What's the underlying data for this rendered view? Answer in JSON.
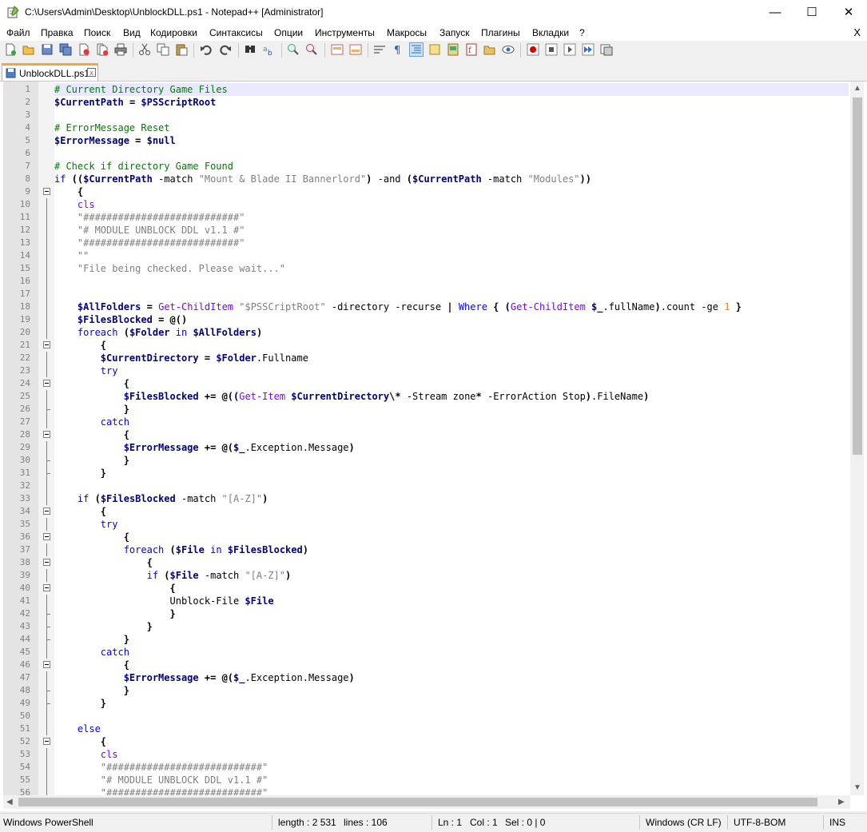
{
  "window": {
    "title": "C:\\Users\\Admin\\Desktop\\UnblockDLL.ps1 - Notepad++ [Administrator]",
    "minimize": "—",
    "maximize": "☐",
    "close": "✕"
  },
  "menu": {
    "items": [
      "Файл",
      "Правка",
      "Поиск",
      "Вид",
      "Кодировки",
      "Синтаксисы",
      "Опции",
      "Инструменты",
      "Макросы",
      "Запуск",
      "Плагины",
      "Вкладки",
      "?"
    ],
    "close_label": "X"
  },
  "tab": {
    "label": "UnblockDLL.ps1",
    "close": "x"
  },
  "colors": {
    "comment": "#008000",
    "keyword": "#0000ff",
    "variable": "#000080",
    "string": "#808080",
    "cmdlet": "#8000ff",
    "number": "#ff8000",
    "current_line": "#e8e8ff"
  },
  "editor": {
    "lines": [
      {
        "n": "1",
        "t": "# Current Directory Game Files"
      },
      {
        "n": "2",
        "t": "$CurrentPath = $PSScriptRoot"
      },
      {
        "n": "3",
        "t": ""
      },
      {
        "n": "4",
        "t": "# ErrorMessage Reset"
      },
      {
        "n": "5",
        "t": "$ErrorMessage = $null"
      },
      {
        "n": "6",
        "t": ""
      },
      {
        "n": "7",
        "t": "# Check if directory Game Found"
      },
      {
        "n": "8",
        "t": "if (($CurrentPath -match \"Mount & Blade II Bannerlord\") -and ($CurrentPath -match \"Modules\"))"
      },
      {
        "n": "9",
        "t": "    {"
      },
      {
        "n": "10",
        "t": "    cls"
      },
      {
        "n": "11",
        "t": "    \"###########################\""
      },
      {
        "n": "12",
        "t": "    \"# MODULE UNBLOCK DDL v1.1 #\""
      },
      {
        "n": "13",
        "t": "    \"###########################\""
      },
      {
        "n": "14",
        "t": "    \"\""
      },
      {
        "n": "15",
        "t": "    \"File being checked. Please wait...\""
      },
      {
        "n": "16",
        "t": ""
      },
      {
        "n": "17",
        "t": ""
      },
      {
        "n": "18",
        "t": "    $AllFolders = Get-ChildItem \"$PSSCriptRoot\" -directory -recurse | Where { (Get-ChildItem $_.fullName).count -ge 1 }"
      },
      {
        "n": "19",
        "t": "    $FilesBlocked = @()"
      },
      {
        "n": "20",
        "t": "    foreach ($Folder in $AllFolders)"
      },
      {
        "n": "21",
        "t": "        {"
      },
      {
        "n": "22",
        "t": "        $CurrentDirectory = $Folder.Fullname"
      },
      {
        "n": "23",
        "t": "        try"
      },
      {
        "n": "24",
        "t": "            {"
      },
      {
        "n": "25",
        "t": "            $FilesBlocked += @((Get-Item $CurrentDirectory\\* -Stream zone* -ErrorAction Stop).FileName)"
      },
      {
        "n": "26",
        "t": "            }"
      },
      {
        "n": "27",
        "t": "        catch"
      },
      {
        "n": "28",
        "t": "            {"
      },
      {
        "n": "29",
        "t": "            $ErrorMessage += @($_.Exception.Message)"
      },
      {
        "n": "30",
        "t": "            }"
      },
      {
        "n": "31",
        "t": "        }"
      },
      {
        "n": "32",
        "t": ""
      },
      {
        "n": "33",
        "t": "    if ($FilesBlocked -match \"[A-Z]\")"
      },
      {
        "n": "34",
        "t": "        {"
      },
      {
        "n": "35",
        "t": "        try"
      },
      {
        "n": "36",
        "t": "            {"
      },
      {
        "n": "37",
        "t": "            foreach ($File in $FilesBlocked)"
      },
      {
        "n": "38",
        "t": "                {"
      },
      {
        "n": "39",
        "t": "                if ($File -match \"[A-Z]\")"
      },
      {
        "n": "40",
        "t": "                    {"
      },
      {
        "n": "41",
        "t": "                    Unblock-File $File"
      },
      {
        "n": "42",
        "t": "                    }"
      },
      {
        "n": "43",
        "t": "                }"
      },
      {
        "n": "44",
        "t": "            }"
      },
      {
        "n": "45",
        "t": "        catch"
      },
      {
        "n": "46",
        "t": "            {"
      },
      {
        "n": "47",
        "t": "            $ErrorMessage += @($_.Exception.Message)"
      },
      {
        "n": "48",
        "t": "            }"
      },
      {
        "n": "49",
        "t": "        }"
      },
      {
        "n": "50",
        "t": ""
      },
      {
        "n": "51",
        "t": "    else"
      },
      {
        "n": "52",
        "t": "        {"
      },
      {
        "n": "53",
        "t": "        cls"
      },
      {
        "n": "54",
        "t": "        \"###########################\""
      },
      {
        "n": "55",
        "t": "        \"# MODULE UNBLOCK DDL v1.1 #\""
      },
      {
        "n": "56",
        "t": "        \"###########################\""
      }
    ]
  },
  "status": {
    "language": "Windows PowerShell",
    "length": "length : 2 531",
    "lines": "lines : 106",
    "ln": "Ln : 1",
    "col": "Col : 1",
    "sel": "Sel : 0 | 0",
    "eol": "Windows (CR LF)",
    "encoding": "UTF-8-BOM",
    "mode": "INS"
  }
}
